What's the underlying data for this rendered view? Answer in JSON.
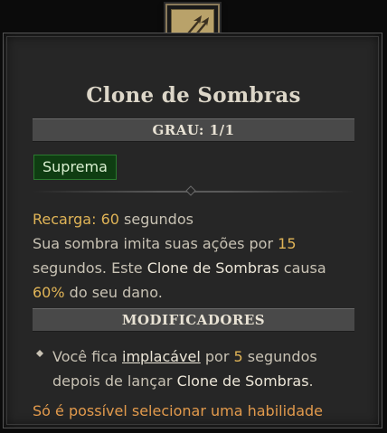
{
  "skill": {
    "title": "Clone de Sombras",
    "rank": "GRAU: 1/1",
    "tier": "Suprema",
    "icon": "shadow-clone-arrows-icon"
  },
  "description": {
    "cooldown_label": "Recarga:",
    "cooldown_value": "60",
    "cooldown_unit": "segundos",
    "line2_a": "Sua sombra imita suas ações por",
    "duration": "15",
    "line3_a": "segundos. Este",
    "skill_ref": "Clone de Sombras",
    "line3_b": "causa",
    "damage_pct": "60%",
    "line4_b": "do seu dano."
  },
  "modifiers": {
    "header": "MODIFICADORES",
    "item_a": "Você fica",
    "item_keyword": "implacável",
    "item_b": "por",
    "item_seconds": "5",
    "item_c": "segundos",
    "item_d": "depois de lançar",
    "item_skill": "Clone de Sombras",
    "item_end": "."
  },
  "footer_note": "Só é possível selecionar uma habilidade",
  "colors": {
    "panel": "#262626",
    "gold": "#e0b457",
    "orange": "#e29a4c",
    "badge_bg": "#0f3d12"
  }
}
